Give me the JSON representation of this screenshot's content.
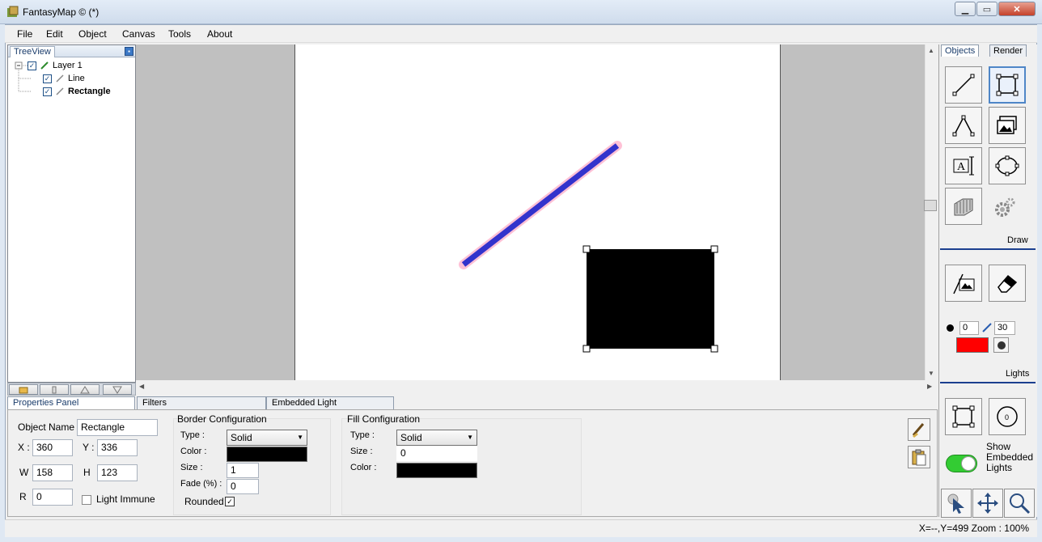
{
  "window": {
    "title": "FantasyMap © (*)",
    "minimize": "▁",
    "maximize": "▭",
    "close": "✕"
  },
  "menu": [
    "File",
    "Edit",
    "Object",
    "Canvas",
    "Tools",
    "About"
  ],
  "treeview": {
    "tab": "TreeView",
    "pin": "▪",
    "items": [
      {
        "label": "Layer 1",
        "checked": true
      },
      {
        "label": "Line",
        "checked": true
      },
      {
        "label": "Rectangle",
        "checked": true
      }
    ]
  },
  "canvas": {
    "line_color": "#3333cc",
    "line_glow": "#ff4d8a",
    "rect_color": "#000000"
  },
  "right_panel": {
    "tabs": [
      "Objects",
      "Render"
    ],
    "draw_label": "Draw",
    "lights_label": "Lights",
    "brush_size_a": "0",
    "brush_size_b": "30",
    "light_color": "#ff0000",
    "show_embedded_lights": "Show Embedded Lights",
    "toggle_color": "#33cc33"
  },
  "bottom_tabs": [
    "Properties Panel",
    "Filters",
    "Embedded Light"
  ],
  "properties": {
    "object_name_label": "Object Name",
    "object_name": "Rectangle",
    "x_label": "X :",
    "x": "360",
    "y_label": "Y :",
    "y": "336",
    "w_label": "W",
    "w": "158",
    "h_label": "H",
    "h": "123",
    "r_label": "R",
    "r": "0",
    "light_immune_label": "Light Immune"
  },
  "border_config": {
    "title": "Border Configuration",
    "type_label": "Type :",
    "type": "Solid",
    "color_label": "Color :",
    "color": "#000000",
    "size_label": "Size :",
    "size": "1",
    "fade_label": "Fade (%) :",
    "fade": "0",
    "rounded_label": "Rounded",
    "rounded": true
  },
  "fill_config": {
    "title": "Fill Configuration",
    "type_label": "Type :",
    "type": "Solid",
    "size_label": "Size :",
    "size": "0",
    "color_label": "Color :",
    "color": "#000000"
  },
  "status": "X=--,Y=499  Zoom : 100%"
}
